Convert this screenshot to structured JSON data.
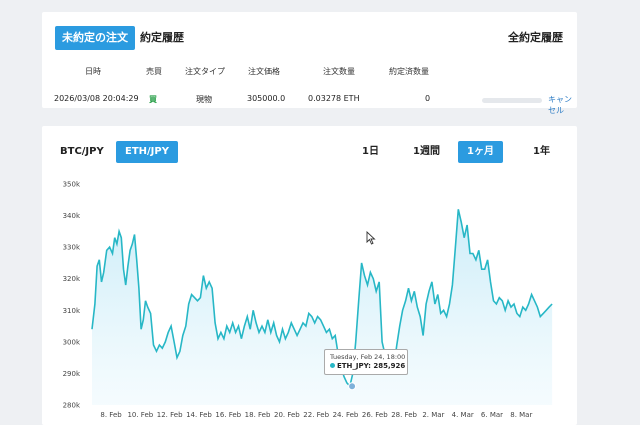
{
  "orders": {
    "tab_open": "未約定の注文",
    "tab_history": "約定履歴",
    "all_history": "全約定履歴",
    "headers": [
      "日時",
      "売買",
      "注文タイプ",
      "注文価格",
      "注文数量",
      "約定済数量"
    ],
    "row": {
      "datetime": "2026/03/08 20:04:29",
      "side": "買",
      "type": "現物",
      "price": "305000.0",
      "quantity": "0.03278 ETH",
      "filled": "0",
      "filled_progress": 0,
      "cancel": "キャンセル"
    }
  },
  "chart_controls": {
    "pairs": [
      "BTC/JPY",
      "ETH/JPY"
    ],
    "active_pair": "ETH/JPY",
    "ranges": [
      "1日",
      "1週間",
      "1ヶ月",
      "1年"
    ],
    "active_range": "1ヶ月"
  },
  "tooltip": {
    "date": "Tuesday, Feb 24, 18:00",
    "label": "ETH_JPY: 285,926"
  },
  "colors": {
    "accent": "#2b9be0",
    "line": "#27b7c6",
    "fill": "#dff3fb",
    "buy": "#2aa04a",
    "link": "#2b7bc4"
  },
  "chart_data": {
    "type": "area",
    "ylim": [
      280000,
      350000
    ],
    "y_ticks": [
      280000,
      290000,
      300000,
      310000,
      320000,
      330000,
      340000,
      350000
    ],
    "y_tick_labels": [
      "280k",
      "290k",
      "300k",
      "310k",
      "320k",
      "330k",
      "340k",
      "350k"
    ],
    "x_ticks": [
      7,
      9,
      11,
      13,
      15,
      17,
      19,
      21,
      23,
      25,
      27,
      29,
      31,
      33,
      35,
      37
    ],
    "x_tick_labels": [
      "8. Feb",
      "10. Feb",
      "12. Feb",
      "14. Feb",
      "16. Feb",
      "18. Feb",
      "20. Feb",
      "22. Feb",
      "24. Feb",
      "26. Feb",
      "28. Feb",
      "2. Mar",
      "4. Mar",
      "6. Mar",
      "8. Mar"
    ],
    "x_range_days": [
      6.0,
      37.6
    ],
    "series": [
      {
        "points": [
          [
            6.0,
            304000
          ],
          [
            6.2,
            312000
          ],
          [
            6.35,
            324000
          ],
          [
            6.5,
            326000
          ],
          [
            6.65,
            319000
          ],
          [
            6.8,
            322000
          ],
          [
            7.0,
            329000
          ],
          [
            7.2,
            330000
          ],
          [
            7.4,
            328000
          ],
          [
            7.55,
            333000
          ],
          [
            7.7,
            331000
          ],
          [
            7.85,
            335000
          ],
          [
            8.0,
            333000
          ],
          [
            8.15,
            323000
          ],
          [
            8.3,
            318000
          ],
          [
            8.45,
            324000
          ],
          [
            8.6,
            329000
          ],
          [
            8.75,
            331000
          ],
          [
            8.9,
            334000
          ],
          [
            9.05,
            326000
          ],
          [
            9.2,
            317000
          ],
          [
            9.35,
            304000
          ],
          [
            9.5,
            307000
          ],
          [
            9.65,
            313000
          ],
          [
            9.8,
            311000
          ],
          [
            10.0,
            309000
          ],
          [
            10.2,
            299000
          ],
          [
            10.4,
            297000
          ],
          [
            10.6,
            299000
          ],
          [
            10.8,
            298000
          ],
          [
            11.0,
            300000
          ],
          [
            11.2,
            303000
          ],
          [
            11.4,
            305000
          ],
          [
            11.6,
            300000
          ],
          [
            11.8,
            295000
          ],
          [
            12.0,
            297000
          ],
          [
            12.2,
            302000
          ],
          [
            12.4,
            305000
          ],
          [
            12.6,
            312000
          ],
          [
            12.8,
            315000
          ],
          [
            13.0,
            314000
          ],
          [
            13.2,
            313000
          ],
          [
            13.4,
            314000
          ],
          [
            13.6,
            321000
          ],
          [
            13.8,
            317000
          ],
          [
            14.0,
            319000
          ],
          [
            14.2,
            317000
          ],
          [
            14.4,
            306000
          ],
          [
            14.6,
            301000
          ],
          [
            14.8,
            303000
          ],
          [
            15.0,
            301000
          ],
          [
            15.2,
            305000
          ],
          [
            15.4,
            303000
          ],
          [
            15.6,
            306000
          ],
          [
            15.8,
            303000
          ],
          [
            16.0,
            305000
          ],
          [
            16.2,
            301000
          ],
          [
            16.4,
            305000
          ],
          [
            16.6,
            308000
          ],
          [
            16.8,
            304000
          ],
          [
            17.0,
            310000
          ],
          [
            17.2,
            306000
          ],
          [
            17.4,
            303000
          ],
          [
            17.6,
            305000
          ],
          [
            17.8,
            303000
          ],
          [
            18.0,
            307000
          ],
          [
            18.2,
            303000
          ],
          [
            18.4,
            306000
          ],
          [
            18.6,
            302000
          ],
          [
            18.8,
            300000
          ],
          [
            19.0,
            304000
          ],
          [
            19.2,
            301000
          ],
          [
            19.4,
            303000
          ],
          [
            19.6,
            306000
          ],
          [
            19.8,
            304000
          ],
          [
            20.0,
            302000
          ],
          [
            20.2,
            304000
          ],
          [
            20.4,
            306000
          ],
          [
            20.6,
            305000
          ],
          [
            20.8,
            309000
          ],
          [
            21.0,
            308000
          ],
          [
            21.2,
            306000
          ],
          [
            21.4,
            308000
          ],
          [
            21.6,
            307000
          ],
          [
            21.8,
            305000
          ],
          [
            22.0,
            303000
          ],
          [
            22.2,
            304000
          ],
          [
            22.4,
            301000
          ],
          [
            22.6,
            302000
          ],
          [
            22.8,
            296000
          ],
          [
            23.0,
            292000
          ],
          [
            23.2,
            289000
          ],
          [
            23.4,
            287000
          ],
          [
            23.6,
            286000
          ],
          [
            23.8,
            290000
          ],
          [
            24.0,
            300000
          ],
          [
            24.2,
            313000
          ],
          [
            24.4,
            325000
          ],
          [
            24.6,
            321000
          ],
          [
            24.8,
            318000
          ],
          [
            25.0,
            322000
          ],
          [
            25.2,
            320000
          ],
          [
            25.4,
            316000
          ],
          [
            25.6,
            319000
          ],
          [
            25.8,
            300000
          ],
          [
            26.0,
            296000
          ],
          [
            26.2,
            296000
          ],
          [
            26.4,
            293000
          ],
          [
            26.6,
            292000
          ],
          [
            26.8,
            299000
          ],
          [
            27.0,
            305000
          ],
          [
            27.2,
            310000
          ],
          [
            27.4,
            313000
          ],
          [
            27.6,
            317000
          ],
          [
            27.8,
            313000
          ],
          [
            28.0,
            316000
          ],
          [
            28.2,
            311000
          ],
          [
            28.4,
            308000
          ],
          [
            28.6,
            302000
          ],
          [
            28.8,
            312000
          ],
          [
            29.0,
            316000
          ],
          [
            29.2,
            319000
          ],
          [
            29.4,
            312000
          ],
          [
            29.6,
            315000
          ],
          [
            29.8,
            309000
          ],
          [
            30.0,
            310000
          ],
          [
            30.2,
            308000
          ],
          [
            30.4,
            312000
          ],
          [
            30.6,
            318000
          ],
          [
            30.8,
            330000
          ],
          [
            31.0,
            342000
          ],
          [
            31.2,
            338000
          ],
          [
            31.4,
            333000
          ],
          [
            31.6,
            337000
          ],
          [
            31.8,
            328000
          ],
          [
            32.0,
            328000
          ],
          [
            32.2,
            326000
          ],
          [
            32.4,
            329000
          ],
          [
            32.6,
            323000
          ],
          [
            32.8,
            323000
          ],
          [
            33.0,
            326000
          ],
          [
            33.2,
            319000
          ],
          [
            33.4,
            313000
          ],
          [
            33.6,
            312000
          ],
          [
            33.8,
            314000
          ],
          [
            34.0,
            313000
          ],
          [
            34.2,
            310000
          ],
          [
            34.4,
            313000
          ],
          [
            34.6,
            311000
          ],
          [
            34.8,
            312000
          ],
          [
            35.0,
            309000
          ],
          [
            35.2,
            308000
          ],
          [
            35.4,
            311000
          ],
          [
            35.6,
            310000
          ],
          [
            35.8,
            312000
          ],
          [
            36.0,
            315000
          ],
          [
            36.2,
            313000
          ],
          [
            36.4,
            311000
          ],
          [
            36.6,
            308000
          ],
          [
            36.8,
            309000
          ],
          [
            37.0,
            310000
          ],
          [
            37.2,
            311000
          ],
          [
            37.4,
            312000
          ]
        ]
      }
    ],
    "highlight": {
      "x": 23.75,
      "y": 285926
    }
  }
}
